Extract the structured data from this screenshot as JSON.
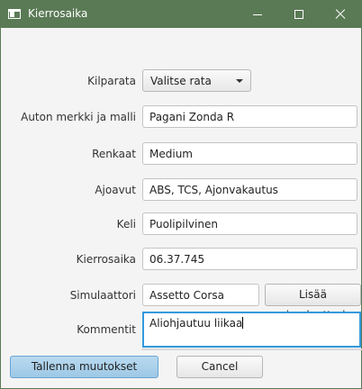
{
  "window": {
    "title": "Kierrosaika"
  },
  "form": {
    "kilparata_label": "Kilparata",
    "kilparata_value": "Valitse rata",
    "auto_label": "Auton merkki ja malli",
    "auto_value": "Pagani Zonda R",
    "renkaat_label": "Renkaat",
    "renkaat_value": "Medium",
    "ajoavut_label": "Ajoavut",
    "ajoavut_value": "ABS, TCS, Ajonvakautus",
    "keli_label": "Keli",
    "keli_value": "Puolipilvinen",
    "kierrosaika_label": "Kierrosaika",
    "kierrosaika_value": "06.37.745",
    "simulaattori_label": "Simulaattori",
    "simulaattori_value": "Assetto Corsa",
    "lisaa_simulaattori": "Lisää simulaattori",
    "kommentit_label": "Kommentit",
    "kommentit_value": "Aliohjautuu liikaa"
  },
  "buttons": {
    "save": "Tallenna muutokset",
    "cancel": "Cancel"
  }
}
